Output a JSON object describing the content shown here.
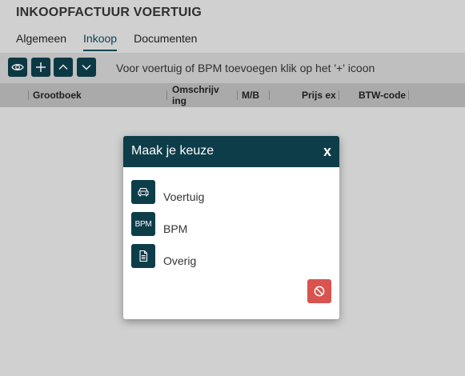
{
  "page": {
    "title": "INKOOPFACTUUR VOERTUIG",
    "tabs": [
      {
        "label": "Algemeen",
        "active": false
      },
      {
        "label": "Inkoop",
        "active": true
      },
      {
        "label": "Documenten",
        "active": false
      }
    ]
  },
  "toolbar": {
    "buttons": [
      {
        "icon": "eye-icon"
      },
      {
        "icon": "plus-icon"
      },
      {
        "icon": "chevron-up-icon"
      },
      {
        "icon": "chevron-down-icon"
      }
    ],
    "hint": "Voor voertuig of BPM toevoegen klik op het '+' icoon"
  },
  "grid": {
    "columns": [
      "Grootboek",
      "Omschrijving",
      "M/B",
      "Prijs ex",
      "BTW-code"
    ]
  },
  "modal": {
    "title": "Maak je keuze",
    "close_label": "x",
    "options": [
      {
        "icon": "car-icon",
        "label": "Voertuig"
      },
      {
        "icon": "bpm-icon",
        "icon_text": "BPM",
        "label": "BPM"
      },
      {
        "icon": "document-icon",
        "label": "Overig"
      }
    ],
    "cancel_icon": "ban-icon"
  },
  "colors": {
    "primary": "#0e3d4a",
    "danger": "#d9534f",
    "background": "#d3d3d3"
  }
}
